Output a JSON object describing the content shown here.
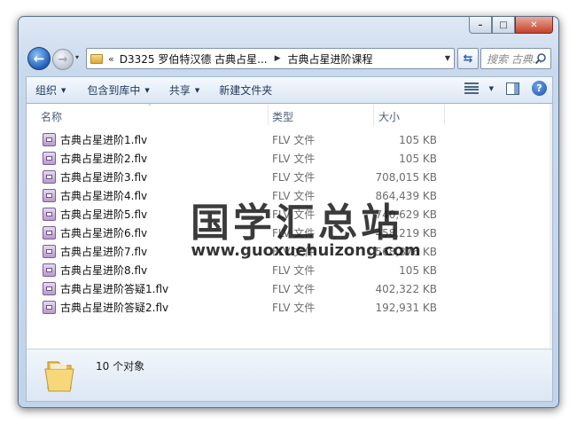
{
  "window": {
    "buttons": {
      "minimize": "–",
      "maximize": "□",
      "close": "✕"
    }
  },
  "nav": {
    "back_glyph": "←",
    "forward_glyph": "→",
    "recent_glyph": "▾",
    "address": {
      "overflow": "«",
      "segments": [
        "D3325 罗伯特汉德 古典占星...",
        "古典占星进阶课程"
      ],
      "separator": "▶",
      "dropdown": "▼"
    },
    "refresh_glyph": "⇆",
    "search_placeholder": "搜索 古典..."
  },
  "toolbar": {
    "items": [
      {
        "label": "组织",
        "has_arrow": true
      },
      {
        "label": "包含到库中",
        "has_arrow": true
      },
      {
        "label": "共享",
        "has_arrow": true
      },
      {
        "label": "新建文件夹",
        "has_arrow": false
      }
    ],
    "arrow_glyph": "▼",
    "view_arrow": "▼",
    "help_glyph": "?"
  },
  "columns": {
    "name": "名称",
    "type": "类型",
    "size": "大小",
    "sort_glyph": "˄"
  },
  "files": [
    {
      "name": "古典占星进阶1.flv",
      "type": "FLV 文件",
      "size": "105 KB"
    },
    {
      "name": "古典占星进阶2.flv",
      "type": "FLV 文件",
      "size": "105 KB"
    },
    {
      "name": "古典占星进阶3.flv",
      "type": "FLV 文件",
      "size": "708,015 KB"
    },
    {
      "name": "古典占星进阶4.flv",
      "type": "FLV 文件",
      "size": "864,439 KB"
    },
    {
      "name": "古典占星进阶5.flv",
      "type": "FLV 文件",
      "size": "740,629 KB"
    },
    {
      "name": "古典占星进阶6.flv",
      "type": "FLV 文件",
      "size": "458,219 KB"
    },
    {
      "name": "古典占星进阶7.flv",
      "type": "FLV 文件",
      "size": "568,876 KB"
    },
    {
      "name": "古典占星进阶8.flv",
      "type": "FLV 文件",
      "size": "105 KB"
    },
    {
      "name": "古典占星进阶答疑1.flv",
      "type": "FLV 文件",
      "size": "402,322 KB"
    },
    {
      "name": "古典占星进阶答疑2.flv",
      "type": "FLV 文件",
      "size": "192,931 KB"
    }
  ],
  "watermark": {
    "title": "国学汇总站",
    "url": "www.guoxuehuizong.com"
  },
  "details": {
    "count": "10 个对象"
  }
}
